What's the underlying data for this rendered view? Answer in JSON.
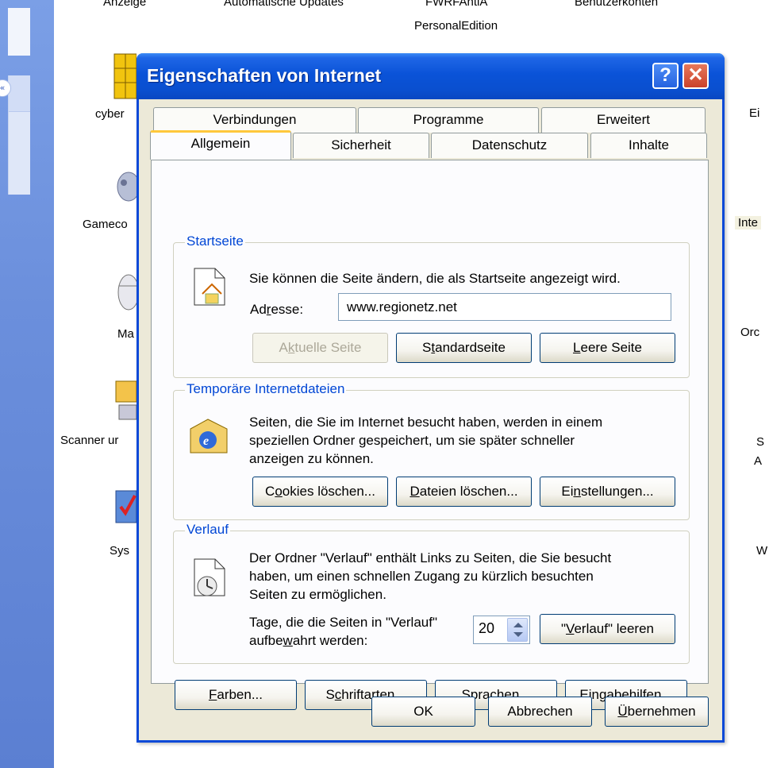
{
  "window": {
    "title": "Eigenschaften von Internet"
  },
  "titlebar": {
    "help_glyph": "?",
    "close_glyph": "✕"
  },
  "background": {
    "top_labels": [
      "Anzeige",
      "Automatische Updates",
      "PersonalEdition",
      "Benutzerkonten"
    ],
    "left_icons": [
      "cyber",
      "Gameco",
      "Ma",
      "Scanner ur",
      "Sys"
    ],
    "right_labels": [
      "Ei",
      "Inte",
      "Orc",
      "S",
      "A",
      "W"
    ]
  },
  "tabs": {
    "row_back": [
      "Verbindungen",
      "Programme",
      "Erweitert"
    ],
    "row_front": [
      "Allgemein",
      "Sicherheit",
      "Datenschutz",
      "Inhalte"
    ],
    "active": "Allgemein"
  },
  "startseite": {
    "title": "Startseite",
    "description": "Sie können die Seite ändern, die als Startseite angezeigt wird.",
    "address_label_pre": "Ad",
    "address_label_u": "r",
    "address_label_post": "esse:",
    "address_value": "www.regionetz.net",
    "btn_current_pre": "A",
    "btn_current_u": "k",
    "btn_current_post": "tuelle Seite",
    "btn_default_pre": "S",
    "btn_default_u": "t",
    "btn_default_post": "andardseite",
    "btn_blank_u": "L",
    "btn_blank_post": "eere Seite"
  },
  "temp_files": {
    "title": "Temporäre Internetdateien",
    "line1": "Seiten, die Sie im Internet besucht haben, werden in einem",
    "line2": "speziellen Ordner gespeichert, um sie später schneller",
    "line3": "anzeigen zu können.",
    "btn_cookies_pre": "C",
    "btn_cookies_u": "o",
    "btn_cookies_post": "okies löschen...",
    "btn_files_u": "D",
    "btn_files_post": "ateien löschen...",
    "btn_settings_pre": "Ei",
    "btn_settings_u": "n",
    "btn_settings_post": "stellungen..."
  },
  "history": {
    "title": "Verlauf",
    "line1": "Der Ordner \"Verlauf\" enthält Links zu Seiten, die Sie besucht",
    "line2": "haben, um einen schnellen Zugang zu kürzlich besuchten",
    "line3": "Seiten zu ermöglichen.",
    "days_line1": "Tage, die die Seiten in \"Verlauf\"",
    "days_line2_pre": "aufbe",
    "days_line2_u": "w",
    "days_line2_post": "ahrt werden:",
    "days_value": "20",
    "btn_clear_pre": "\"",
    "btn_clear_u": "V",
    "btn_clear_post": "erlauf\" leeren"
  },
  "bottom_buttons": {
    "colors_u": "F",
    "colors_post": "arben...",
    "fonts_pre": "S",
    "fonts_u": "c",
    "fonts_post": "hriftarten...",
    "langs_u": "S",
    "langs_post": "prachen...",
    "access_u": "E",
    "access_post": "ingabehilfen..."
  },
  "dialog_buttons": {
    "ok": "OK",
    "cancel": "Abbrechen",
    "apply_u": "Ü",
    "apply_post": "bernehmen"
  }
}
